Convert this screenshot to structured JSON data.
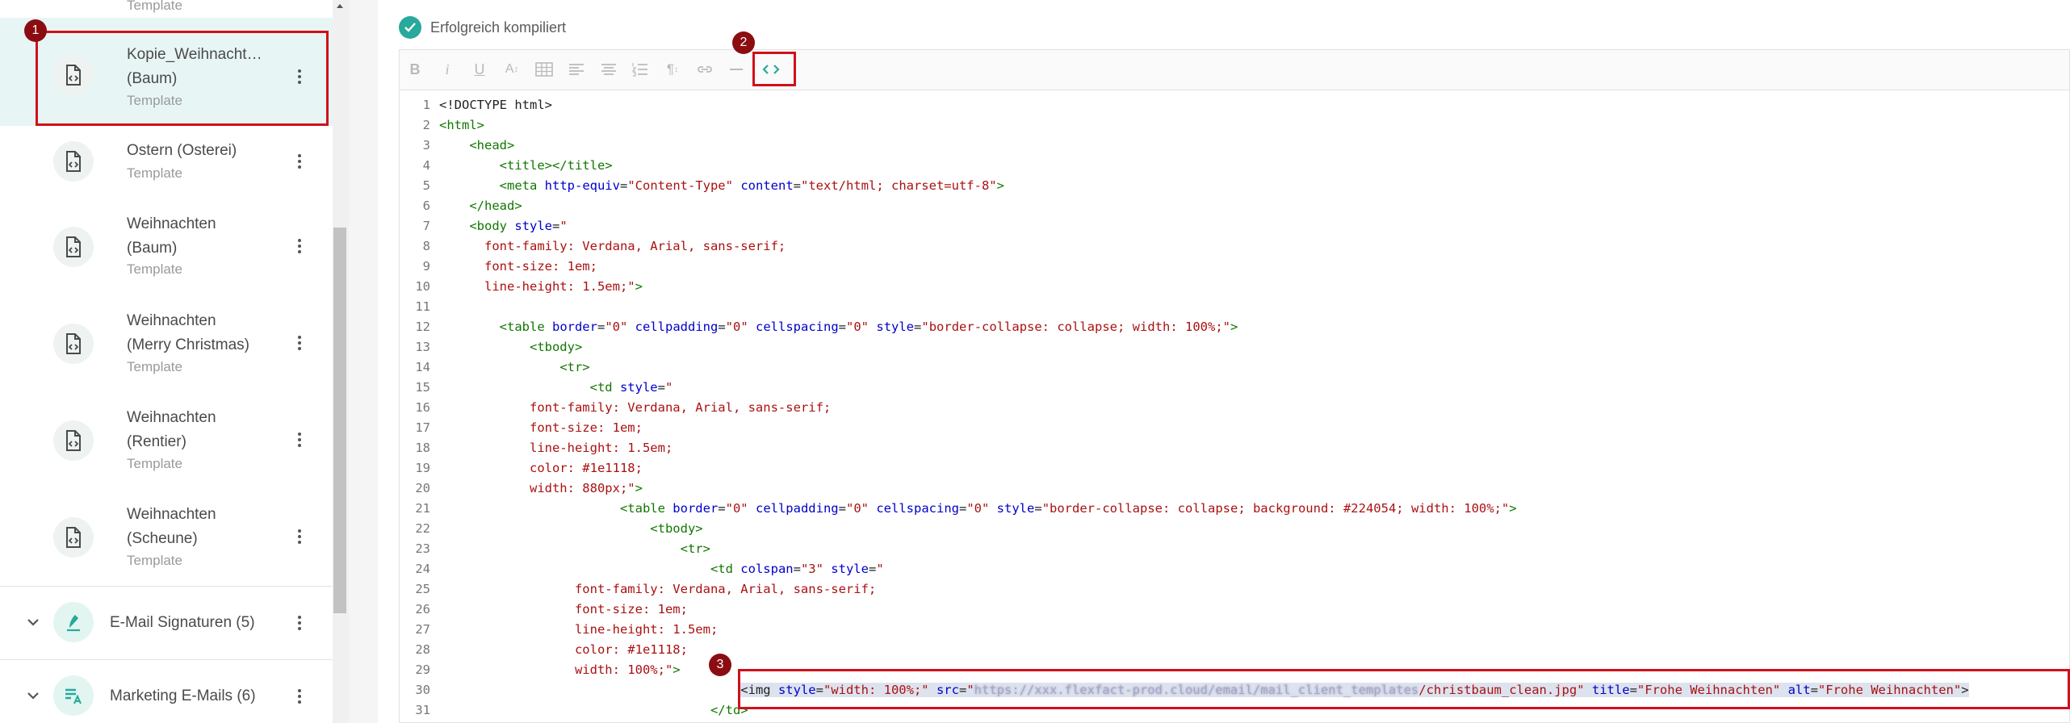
{
  "sidebar": {
    "top_partial_sub": "Template",
    "templates": [
      {
        "title_lines": [
          "Kopie_Weihnacht…",
          "(Baum)"
        ],
        "subtitle": "Template"
      },
      {
        "title_lines": [
          "Ostern (Osterei)"
        ],
        "subtitle": "Template"
      },
      {
        "title_lines": [
          "Weihnachten",
          "(Baum)"
        ],
        "subtitle": "Template"
      },
      {
        "title_lines": [
          "Weihnachten",
          "(Merry Christmas)"
        ],
        "subtitle": "Template"
      },
      {
        "title_lines": [
          "Weihnachten",
          "(Rentier)"
        ],
        "subtitle": "Template"
      },
      {
        "title_lines": [
          "Weihnachten",
          "(Scheune)"
        ],
        "subtitle": "Template"
      }
    ],
    "categories": [
      {
        "label": "E-Mail Signaturen (5)"
      },
      {
        "label": "Marketing E-Mails (6)"
      }
    ]
  },
  "status": {
    "text": "Erfolgreich kompiliert"
  },
  "toolbar": {
    "buttons": [
      "bold",
      "italic",
      "underline",
      "font-size",
      "table",
      "align-left",
      "align-center",
      "list",
      "paragraph",
      "link",
      "horizontal-rule",
      "source-code"
    ]
  },
  "badges": [
    "1",
    "2",
    "3"
  ],
  "editor": {
    "line_numbers": [
      "1",
      "2",
      "3",
      "4",
      "5",
      "6",
      "7",
      "8",
      "9",
      "10",
      "11",
      "12",
      "13",
      "14",
      "15",
      "16",
      "17",
      "18",
      "19",
      "20",
      "21",
      "22",
      "23",
      "24",
      "25",
      "26",
      "27",
      "28",
      "29",
      "30",
      "31"
    ],
    "lines": [
      [
        [
          "t",
          "<!DOCTYPE html>"
        ]
      ],
      [
        [
          "g",
          "<html>"
        ]
      ],
      [
        [
          "t",
          "    "
        ],
        [
          "g",
          "<head>"
        ]
      ],
      [
        [
          "t",
          "        "
        ],
        [
          "g",
          "<title></title>"
        ]
      ],
      [
        [
          "t",
          "        "
        ],
        [
          "g",
          "<meta "
        ],
        [
          "a",
          "http-equiv"
        ],
        [
          "t",
          "="
        ],
        [
          "s",
          "\"Content-Type\""
        ],
        [
          "t",
          " "
        ],
        [
          "a",
          "content"
        ],
        [
          "t",
          "="
        ],
        [
          "s",
          "\"text/html; charset=utf-8\""
        ],
        [
          "g",
          ">"
        ]
      ],
      [
        [
          "t",
          "    "
        ],
        [
          "g",
          "</head>"
        ]
      ],
      [
        [
          "t",
          "    "
        ],
        [
          "g",
          "<body "
        ],
        [
          "a",
          "style"
        ],
        [
          "t",
          "="
        ],
        [
          "s",
          "\""
        ]
      ],
      [
        [
          "s",
          "      font-family: Verdana, Arial, sans-serif;"
        ]
      ],
      [
        [
          "s",
          "      font-size: 1em;"
        ]
      ],
      [
        [
          "s",
          "      line-height: 1.5em;\""
        ],
        [
          "g",
          ">"
        ]
      ],
      [
        [
          "t",
          ""
        ]
      ],
      [
        [
          "t",
          "        "
        ],
        [
          "g",
          "<table "
        ],
        [
          "a",
          "border"
        ],
        [
          "t",
          "="
        ],
        [
          "s",
          "\"0\""
        ],
        [
          "t",
          " "
        ],
        [
          "a",
          "cellpadding"
        ],
        [
          "t",
          "="
        ],
        [
          "s",
          "\"0\""
        ],
        [
          "t",
          " "
        ],
        [
          "a",
          "cellspacing"
        ],
        [
          "t",
          "="
        ],
        [
          "s",
          "\"0\""
        ],
        [
          "t",
          " "
        ],
        [
          "a",
          "style"
        ],
        [
          "t",
          "="
        ],
        [
          "s",
          "\"border-collapse: collapse; width: 100%;\""
        ],
        [
          "g",
          ">"
        ]
      ],
      [
        [
          "t",
          "            "
        ],
        [
          "g",
          "<tbody>"
        ]
      ],
      [
        [
          "t",
          "                "
        ],
        [
          "g",
          "<tr>"
        ]
      ],
      [
        [
          "t",
          "                    "
        ],
        [
          "g",
          "<td "
        ],
        [
          "a",
          "style"
        ],
        [
          "t",
          "="
        ],
        [
          "s",
          "\""
        ]
      ],
      [
        [
          "s",
          "            font-family: Verdana, Arial, sans-serif;"
        ]
      ],
      [
        [
          "s",
          "            font-size: 1em;"
        ]
      ],
      [
        [
          "s",
          "            line-height: 1.5em;"
        ]
      ],
      [
        [
          "s",
          "            color: #1e1118;"
        ]
      ],
      [
        [
          "s",
          "            width: 880px;\""
        ],
        [
          "g",
          ">"
        ]
      ],
      [
        [
          "t",
          "                        "
        ],
        [
          "g",
          "<table "
        ],
        [
          "a",
          "border"
        ],
        [
          "t",
          "="
        ],
        [
          "s",
          "\"0\""
        ],
        [
          "t",
          " "
        ],
        [
          "a",
          "cellpadding"
        ],
        [
          "t",
          "="
        ],
        [
          "s",
          "\"0\""
        ],
        [
          "t",
          " "
        ],
        [
          "a",
          "cellspacing"
        ],
        [
          "t",
          "="
        ],
        [
          "s",
          "\"0\""
        ],
        [
          "t",
          " "
        ],
        [
          "a",
          "style"
        ],
        [
          "t",
          "="
        ],
        [
          "s",
          "\"border-collapse: collapse; background: #224054; width: 100%;\""
        ],
        [
          "g",
          ">"
        ]
      ],
      [
        [
          "t",
          "                            "
        ],
        [
          "g",
          "<tbody>"
        ]
      ],
      [
        [
          "t",
          "                                "
        ],
        [
          "g",
          "<tr>"
        ]
      ],
      [
        [
          "t",
          "                                    "
        ],
        [
          "g",
          "<td "
        ],
        [
          "a",
          "colspan"
        ],
        [
          "t",
          "="
        ],
        [
          "s",
          "\"3\""
        ],
        [
          "t",
          " "
        ],
        [
          "a",
          "style"
        ],
        [
          "t",
          "="
        ],
        [
          "s",
          "\""
        ]
      ],
      [
        [
          "s",
          "                  font-family: Verdana, Arial, sans-serif;"
        ]
      ],
      [
        [
          "s",
          "                  font-size: 1em;"
        ]
      ],
      [
        [
          "s",
          "                  line-height: 1.5em;"
        ]
      ],
      [
        [
          "s",
          "                  color: #1e1118;"
        ]
      ],
      [
        [
          "s",
          "                  width: 100%;\""
        ],
        [
          "g",
          ">"
        ]
      ],
      [
        [
          "t",
          "                                        "
        ],
        [
          "h",
          "<img "
        ],
        [
          "ha",
          "style"
        ],
        [
          "h",
          "="
        ],
        [
          "hs",
          "\"width: 100%;\""
        ],
        [
          "h",
          " "
        ],
        [
          "ha",
          "src"
        ],
        [
          "h",
          "="
        ],
        [
          "hs",
          "\""
        ],
        [
          "hb",
          "https://xxx.flexfact-prod.cloud/email/mail_client_templates"
        ],
        [
          "hs",
          "/christbaum_clean.jpg\""
        ],
        [
          "h",
          " "
        ],
        [
          "ha",
          "title"
        ],
        [
          "h",
          "="
        ],
        [
          "hs",
          "\"Frohe Weihnachten\""
        ],
        [
          "h",
          " "
        ],
        [
          "ha",
          "alt"
        ],
        [
          "h",
          "="
        ],
        [
          "hs",
          "\"Frohe Weihnachten\""
        ],
        [
          "h",
          ">"
        ]
      ],
      [
        [
          "t",
          "                                    "
        ],
        [
          "g",
          "</td>"
        ]
      ]
    ]
  }
}
